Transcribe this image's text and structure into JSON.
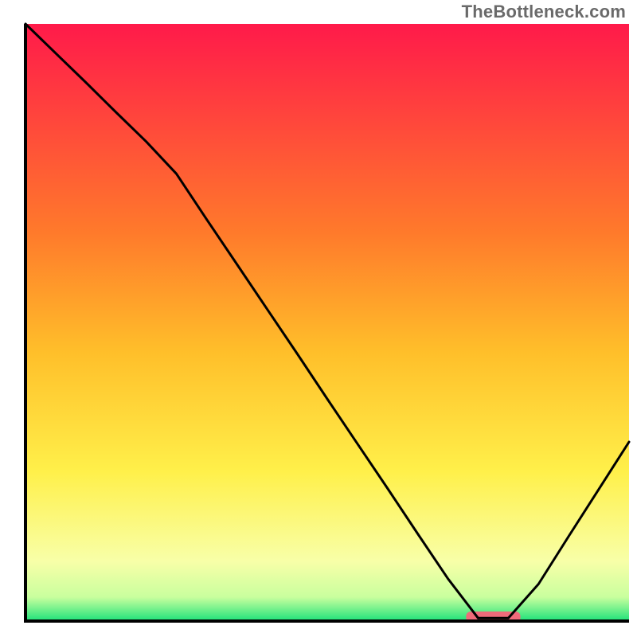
{
  "watermark": "TheBottleneck.com",
  "chart_data": {
    "type": "line",
    "title": "",
    "xlabel": "",
    "ylabel": "",
    "xlim": [
      0,
      100
    ],
    "ylim": [
      0,
      100
    ],
    "x": [
      0,
      5,
      10,
      15,
      20,
      25,
      30,
      35,
      40,
      45,
      50,
      55,
      60,
      65,
      70,
      75,
      80,
      85,
      90,
      95,
      100
    ],
    "values": [
      100,
      95.1,
      90.2,
      85.2,
      80.3,
      74.9,
      67.3,
      59.8,
      52.3,
      44.8,
      37.2,
      29.7,
      22.2,
      14.6,
      7.1,
      0.5,
      0.5,
      6.2,
      14.2,
      22.1,
      30.0
    ],
    "optimum_range": {
      "start": 73,
      "end": 82
    },
    "gradient_stops": [
      {
        "pct": 0,
        "color": "#ff1a4a"
      },
      {
        "pct": 35,
        "color": "#ff7a2b"
      },
      {
        "pct": 55,
        "color": "#ffbf2a"
      },
      {
        "pct": 75,
        "color": "#fff04a"
      },
      {
        "pct": 90,
        "color": "#f8ffa8"
      },
      {
        "pct": 96,
        "color": "#c9ff9e"
      },
      {
        "pct": 100,
        "color": "#1de27a"
      }
    ]
  }
}
